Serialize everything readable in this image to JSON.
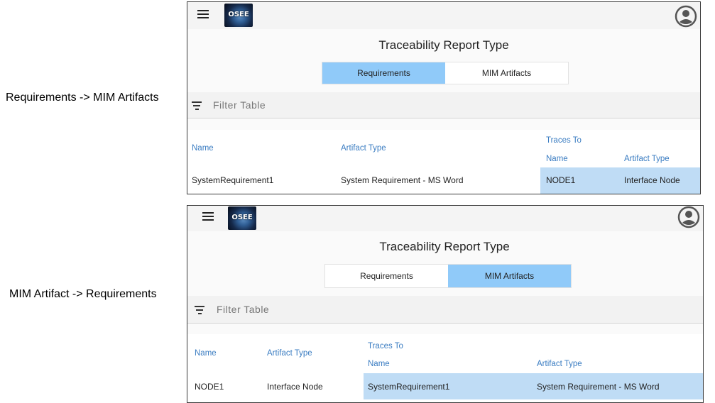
{
  "labels": {
    "top": "Requirements -> MIM Artifacts",
    "bottom": "MIM Artifact -> Requirements"
  },
  "app": {
    "logo_text": "OSEE",
    "title": "Traceability Report Type",
    "tabs": [
      "Requirements",
      "MIM Artifacts"
    ],
    "filter_placeholder": "Filter Table",
    "accent_color": "#90caf9",
    "header_color": "#3b7dc2"
  },
  "panel1": {
    "active_tab": "Requirements",
    "headers": {
      "name": "Name",
      "artifact_type": "Artifact Type",
      "traces_to": "Traces To",
      "trace_name": "Name",
      "trace_artifact_type": "Artifact Type"
    },
    "row": {
      "name": "SystemRequirement1",
      "artifact_type": "System Requirement - MS Word",
      "trace_name": "NODE1",
      "trace_artifact_type": "Interface Node"
    }
  },
  "panel2": {
    "active_tab": "MIM Artifacts",
    "headers": {
      "name": "Name",
      "artifact_type": "Artifact Type",
      "traces_to": "Traces To",
      "trace_name": "Name",
      "trace_artifact_type": "Artifact Type"
    },
    "row": {
      "name": "NODE1",
      "artifact_type": "Interface Node",
      "trace_name": "SystemRequirement1",
      "trace_artifact_type": "System Requirement - MS Word"
    }
  }
}
